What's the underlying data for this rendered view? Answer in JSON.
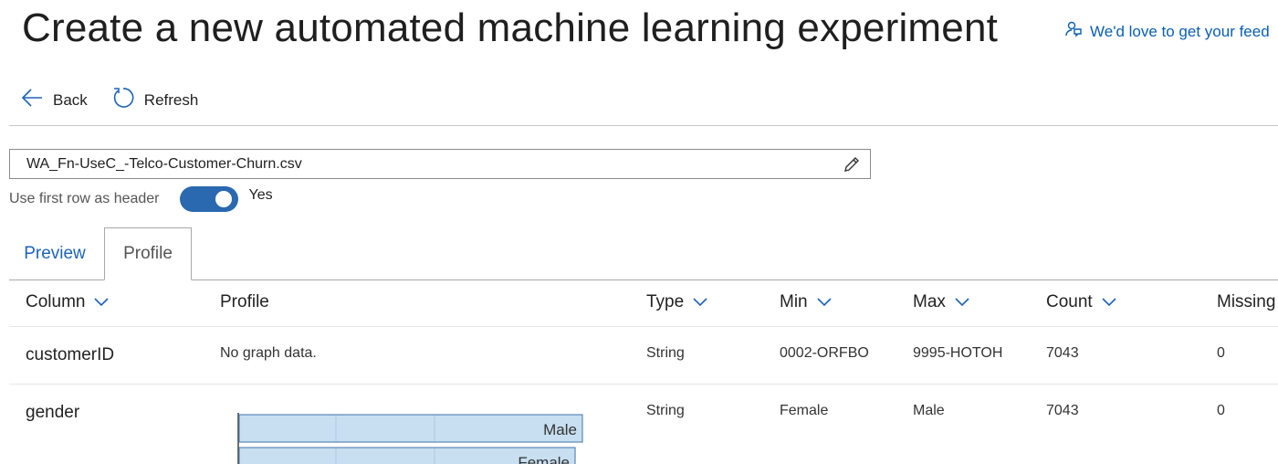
{
  "header": {
    "title": "Create a new automated machine learning experiment",
    "feedback_label": "We'd love to get your feed"
  },
  "toolbar": {
    "back_label": "Back",
    "refresh_label": "Refresh"
  },
  "dataset": {
    "file_name": "WA_Fn-UseC_-Telco-Customer-Churn.csv",
    "header_toggle_label": "Use first row as header",
    "header_toggle_state": "Yes"
  },
  "tabs": [
    {
      "label": "Preview"
    },
    {
      "label": "Profile"
    }
  ],
  "table": {
    "columns": [
      "Column",
      "Profile",
      "Type",
      "Min",
      "Max",
      "Count",
      "Missing"
    ],
    "rows": [
      {
        "column": "customerID",
        "profile": "No graph data.",
        "type": "String",
        "min": "0002-ORFBO",
        "max": "9995-HOTOH",
        "count": "7043",
        "missing": "0"
      },
      {
        "column": "gender",
        "profile": "",
        "type": "String",
        "min": "Female",
        "max": "Male",
        "count": "7043",
        "missing": "0"
      }
    ]
  },
  "gender_chart": {
    "type": "bar",
    "orientation": "horizontal",
    "categories": [
      "Male",
      "Female"
    ],
    "bar_color": "#c7dff0",
    "border_color": "#5b86b8"
  },
  "colors": {
    "accent": "#1c63b8",
    "toggle_on": "#2a68b0"
  }
}
